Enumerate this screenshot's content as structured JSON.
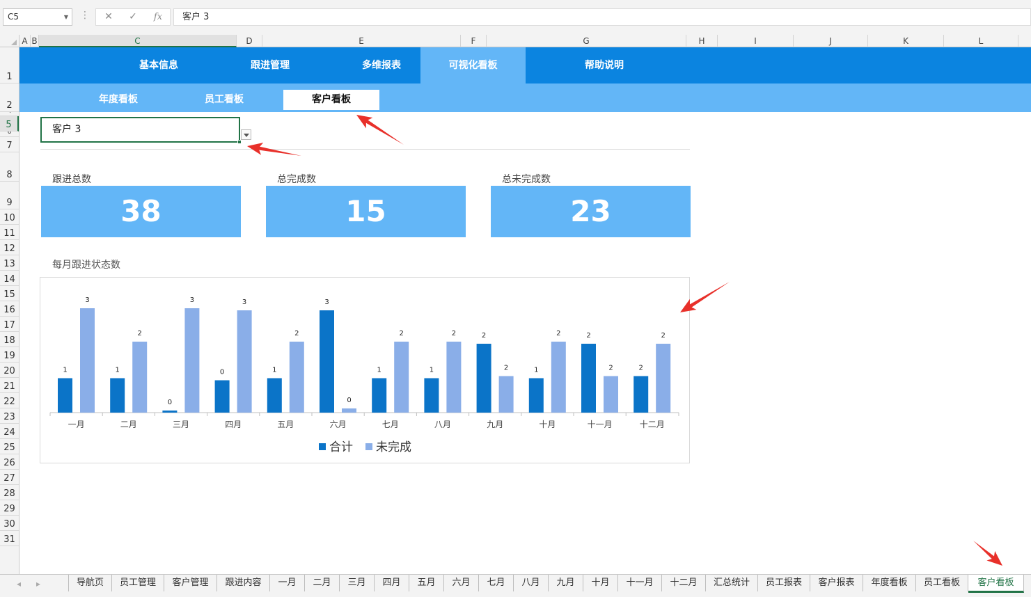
{
  "formula_bar": {
    "name_box": "C5",
    "content": "客户 3",
    "cancel_icon": "x-icon",
    "confirm_icon": "check-icon",
    "fx_label": "fx"
  },
  "columns": [
    "A",
    "B",
    "C",
    "D",
    "E",
    "F",
    "G",
    "H",
    "I",
    "J",
    "K",
    "L"
  ],
  "rows": [
    "1",
    "2",
    "4",
    "5",
    "6",
    "7",
    "8",
    "9",
    "10",
    "11",
    "12",
    "13",
    "14",
    "15",
    "16",
    "17",
    "18",
    "19",
    "20",
    "21",
    "22",
    "23",
    "24",
    "25",
    "26",
    "27",
    "28",
    "29",
    "30",
    "31"
  ],
  "nav_main": [
    {
      "label": "基本信息"
    },
    {
      "label": "跟进管理"
    },
    {
      "label": "多维报表"
    },
    {
      "label": "可视化看板",
      "active": true
    },
    {
      "label": "帮助说明"
    }
  ],
  "nav_sub": [
    {
      "label": "年度看板"
    },
    {
      "label": "员工看板"
    },
    {
      "label": "客户看板",
      "active": true
    }
  ],
  "selector": {
    "value": "客户 3"
  },
  "kpis": [
    {
      "label": "跟进总数",
      "value": "38"
    },
    {
      "label": "总完成数",
      "value": "15"
    },
    {
      "label": "总未完成数",
      "value": "23"
    }
  ],
  "chart_title": "每月跟进状态数",
  "chart_data": {
    "type": "bar",
    "categories": [
      "一月",
      "二月",
      "三月",
      "四月",
      "五月",
      "六月",
      "七月",
      "八月",
      "九月",
      "十月",
      "十一月",
      "十二月"
    ],
    "series": [
      {
        "name": "合计",
        "color": "#0b74c8",
        "values": [
          1,
          1,
          0,
          0,
          1,
          3,
          1,
          1,
          2,
          1,
          2,
          2
        ],
        "heights": [
          0.33,
          0.33,
          0.02,
          0.31,
          0.33,
          0.98,
          0.33,
          0.33,
          0.66,
          0.33,
          0.66,
          0.35
        ]
      },
      {
        "name": "未完成",
        "color": "#8aaee8",
        "values": [
          3,
          2,
          3,
          3,
          2,
          0,
          2,
          2,
          2,
          2,
          2,
          2
        ],
        "heights": [
          1.0,
          0.68,
          1.0,
          0.98,
          0.68,
          0.04,
          0.68,
          0.68,
          0.35,
          0.68,
          0.35,
          0.66
        ]
      }
    ],
    "legend": "bottom",
    "grid": false
  },
  "sheet_tabs": [
    {
      "label": "导航页"
    },
    {
      "label": "员工管理"
    },
    {
      "label": "客户管理"
    },
    {
      "label": "跟进内容"
    },
    {
      "label": "一月"
    },
    {
      "label": "二月"
    },
    {
      "label": "三月"
    },
    {
      "label": "四月"
    },
    {
      "label": "五月"
    },
    {
      "label": "六月"
    },
    {
      "label": "七月"
    },
    {
      "label": "八月"
    },
    {
      "label": "九月"
    },
    {
      "label": "十月"
    },
    {
      "label": "十一月"
    },
    {
      "label": "十二月"
    },
    {
      "label": "汇总统计"
    },
    {
      "label": "员工报表"
    },
    {
      "label": "客户报表"
    },
    {
      "label": "年度看板"
    },
    {
      "label": "员工看板"
    },
    {
      "label": "客户看板",
      "active": true
    }
  ],
  "colors": {
    "nav_primary": "#0b84e0",
    "nav_secondary": "#63b6f7",
    "excel_green": "#217346",
    "annotation_red": "#e8302a"
  }
}
